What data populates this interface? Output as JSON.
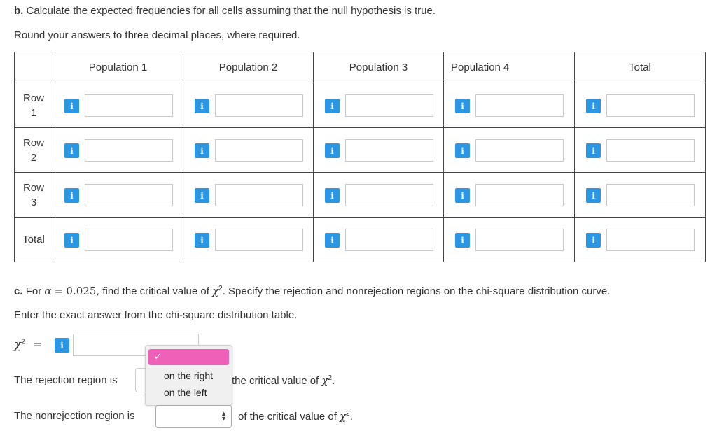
{
  "part_b": {
    "letter": "b.",
    "instruction": "Calculate the expected frequencies for all cells assuming that the null hypothesis is true.",
    "rounding": "Round your answers to three decimal places, where required."
  },
  "table": {
    "headers": [
      "Population 1",
      "Population 2",
      "Population 3",
      "Population 4",
      "Total"
    ],
    "rows": [
      {
        "label_line1": "Row",
        "label_line2": "1"
      },
      {
        "label_line1": "Row",
        "label_line2": "2"
      },
      {
        "label_line1": "Row",
        "label_line2": "3"
      },
      {
        "label_line1": "Total",
        "label_line2": ""
      }
    ],
    "info_glyph": "i",
    "cell_values": ""
  },
  "part_c": {
    "letter": "c.",
    "text_pre": "For",
    "alpha_symbol": "α",
    "equals": "=",
    "alpha_value": "0.025,",
    "text_mid": "find the critical value of",
    "chi": "χ",
    "sup": "2",
    "text_post": ". Specify the rejection and nonrejection regions on the chi-square distribution curve.",
    "exact": "Enter the exact answer from the chi-square distribution table.",
    "chi_input_value": ""
  },
  "rejection": {
    "label": "The rejection region is",
    "suffix": "the critical value of",
    "selected_value": "",
    "options": [
      "on the right",
      "on the left"
    ],
    "checkmark": "✓"
  },
  "nonrejection": {
    "label": "The nonrejection region is",
    "suffix": "of the critical value of",
    "selected_value": ""
  },
  "icons": {
    "info": "info-icon",
    "check": "checkmark-icon",
    "select_arrows": "updown-arrows-icon"
  },
  "colors": {
    "info_blue": "#2b96e3",
    "dropdown_highlight": "#ef61b9"
  }
}
